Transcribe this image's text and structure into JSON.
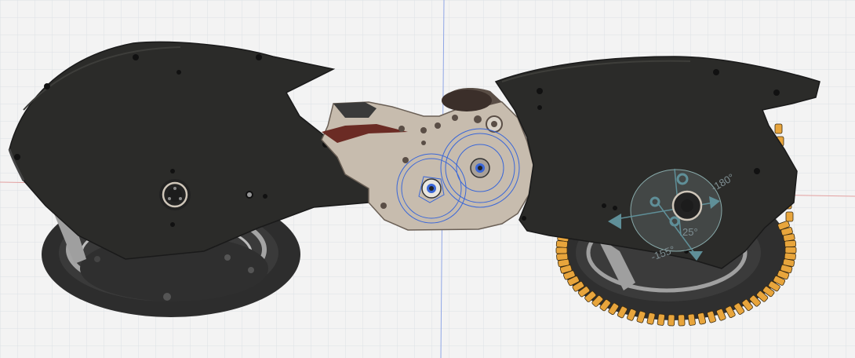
{
  "viewport": {
    "background": "#f3f3f3",
    "grid_color": "#d9dde3",
    "axis_x_color": "#e3a0a0",
    "axis_y_color": "#8fa6e6"
  },
  "model": {
    "body_color": "#2b2b29",
    "plate_color": "#c7bcae",
    "tire_color": "#2d2d2d",
    "rim_color": "#9a9a9a",
    "tread_accent": "#e8a53c",
    "sketch_color": "#3a67d8",
    "manipulator_color": "#5f8f98"
  },
  "rotate_manipulator": {
    "angle_labels": [
      "-180°",
      "-155°",
      "25°"
    ]
  }
}
